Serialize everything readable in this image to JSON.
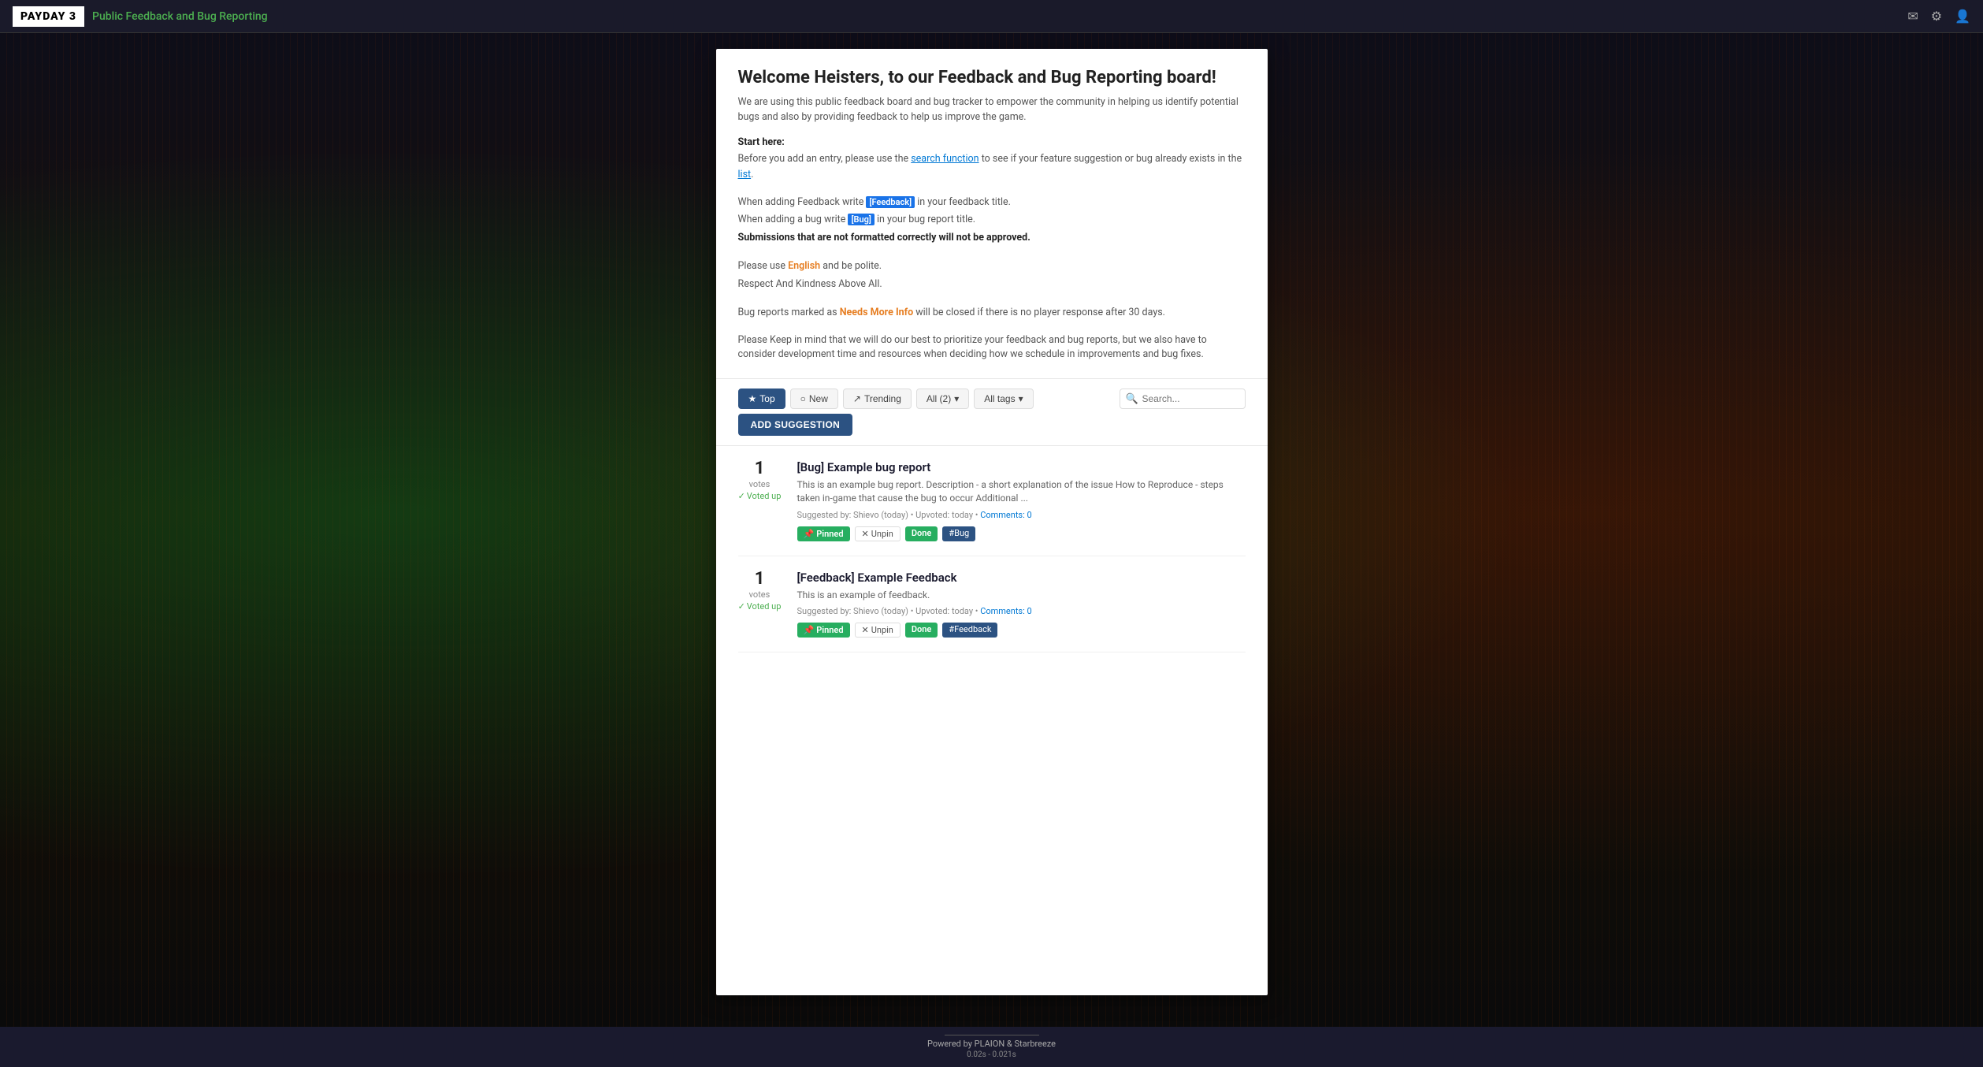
{
  "navbar": {
    "logo": "PAYDAY 3",
    "title": "Public Feedback and Bug Reporting",
    "icons": [
      "mail-icon",
      "gear-icon",
      "user-icon"
    ]
  },
  "welcome": {
    "title": "Welcome Heisters, to our Feedback and Bug Reporting board!",
    "description": "We are using this public feedback board and bug tracker to empower the community in helping us identify potential bugs and also by providing feedback to help us improve the game.",
    "start_here_label": "Start here:",
    "start_here_desc": "Before you add an entry, please use the search function to see if your feature suggestion or bug already exists in the list.",
    "format_rule_1": "When adding Feedback write [Feedback] in your feedback title.",
    "format_rule_2": "When adding a bug write [Bug] in your bug report title.",
    "format_rule_3": "Submissions that are not formatted correctly will not be approved.",
    "polite_rule_1": "Please use English and be polite.",
    "polite_rule_2": "Respect And Kindness Above All.",
    "needs_more_info_text": "Bug reports marked as",
    "needs_more_info_label": "Needs More Info",
    "needs_more_info_suffix": "will be closed if there is no player response after 30 days.",
    "closing": "Please Keep in mind that we will do our best to prioritize your feedback and bug reports, but we also have to consider development time and resources when deciding how we schedule in improvements and bug fixes."
  },
  "filters": {
    "top_label": "Top",
    "new_label": "New",
    "trending_label": "Trending",
    "all_label": "All (2)",
    "all_tags_label": "All tags",
    "search_placeholder": "Search...",
    "add_button_label": "ADD SUGGESTION"
  },
  "posts": [
    {
      "vote_count": "1",
      "votes_label": "votes",
      "voted_label": "Voted up",
      "title": "[Bug] Example bug report",
      "excerpt": "This is an example bug report. Description - a short explanation of the issue How to Reproduce - steps taken in-game that cause the bug to occur Additional ...",
      "meta": "Suggested by: Shievo (today) • Upvoted: today •",
      "comments_label": "Comments: 0",
      "tags": [
        "Pinned",
        "Unpin",
        "Done",
        "#Bug"
      ]
    },
    {
      "vote_count": "1",
      "votes_label": "votes",
      "voted_label": "Voted up",
      "title": "[Feedback] Example Feedback",
      "excerpt": "This is an example of feedback.",
      "meta": "Suggested by: Shievo (today) • Upvoted: today •",
      "comments_label": "Comments: 0",
      "tags": [
        "Pinned",
        "Unpin",
        "Done",
        "#Feedback"
      ]
    }
  ],
  "footer": {
    "powered_by": "Powered by PLAION & Starbreeze",
    "timing": "0.02s - 0.021s"
  }
}
